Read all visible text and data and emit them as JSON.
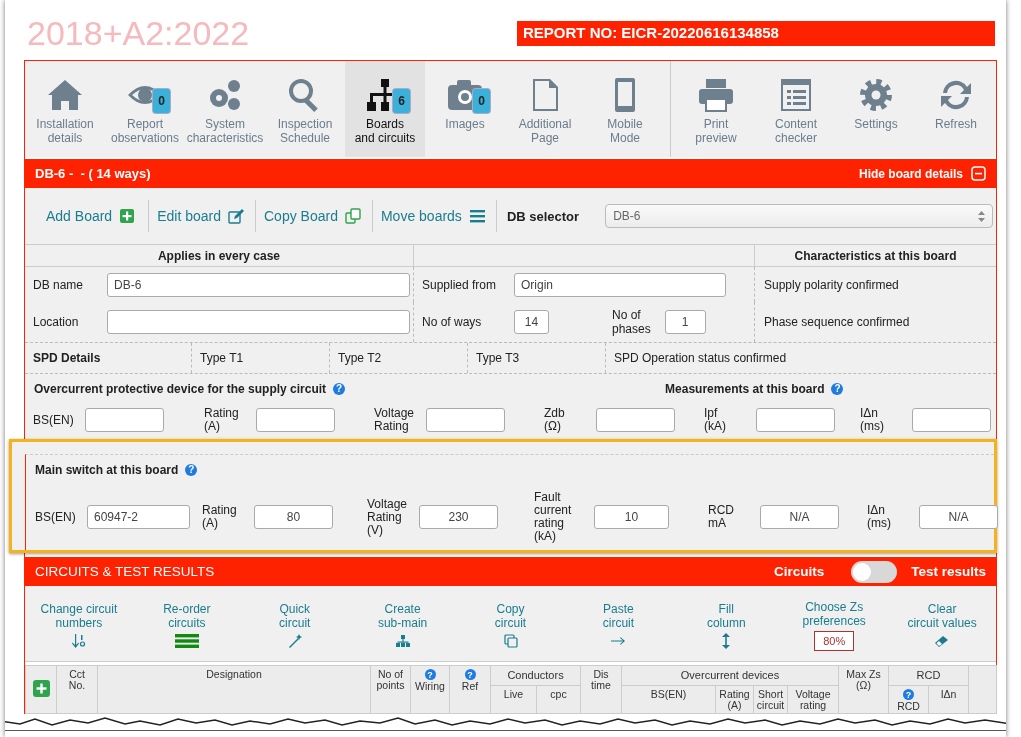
{
  "header": {
    "edition": "2018+A2:2022",
    "report_no": "REPORT NO: EICR-20220616134858"
  },
  "toolbar": [
    {
      "items": [
        {
          "label": "Installation\ndetails",
          "selected": false
        },
        {
          "label": "Report\nobservations",
          "badge": "0",
          "selected": false
        },
        {
          "label": "System\ncharacteristics",
          "selected": false
        },
        {
          "label": "Inspection\nSchedule",
          "selected": false
        },
        {
          "label": "Boards\nand circuits",
          "badge": "6",
          "selected": true
        },
        {
          "label": "Images",
          "badge": "0",
          "selected": false
        },
        {
          "label": "Additional\nPage",
          "selected": false
        },
        {
          "label": "Mobile\nMode",
          "selected": false
        }
      ]
    },
    {
      "items": [
        {
          "label": "Print\npreview",
          "selected": false
        },
        {
          "label": "Content\nchecker",
          "selected": false
        },
        {
          "label": "Settings",
          "selected": false
        },
        {
          "label": "Refresh",
          "selected": false
        }
      ]
    }
  ],
  "board": {
    "title": "DB-6 -  - ( 14 ways)",
    "hide_button": "Hide board details",
    "actions": [
      "Add Board",
      "Edit board",
      "Copy Board",
      "Move boards"
    ],
    "db_selector": {
      "label": "DB selector",
      "value": "DB-6"
    },
    "applies_heading": "Applies in every case",
    "characteristics_heading": "Characteristics at this board",
    "db_name": {
      "label": "DB name",
      "value": "DB-6"
    },
    "location": {
      "label": "Location"
    },
    "supplied_from": {
      "label": "Supplied from",
      "value": "Origin"
    },
    "no_of_ways": {
      "label": "No of ways",
      "value": "14"
    },
    "no_of_phases": {
      "label": "No of\nphases",
      "value": "1"
    },
    "characteristics": [
      "Supply polarity confirmed",
      "Phase sequence confirmed"
    ],
    "spd": {
      "title": "SPD Details",
      "types": [
        "Type T1",
        "Type T2",
        "Type T3"
      ],
      "status": "SPD Operation status confirmed"
    },
    "overcurrent": {
      "title": "Overcurrent protective device for the supply circuit",
      "help": "?",
      "fields": [
        {
          "label": "BS(EN)"
        },
        {
          "label": "Rating\n(A)"
        },
        {
          "label": "Voltage\nRating"
        }
      ]
    },
    "measurements": {
      "title": "Measurements at this board",
      "help": "?",
      "fields": [
        {
          "label": "Zdb\n(Ω)"
        },
        {
          "label": "Ipf\n(kA)"
        },
        {
          "label": "IΔn\n(ms)"
        }
      ]
    },
    "main_switch": {
      "title": "Main switch at this board",
      "help": "?",
      "fields": [
        {
          "label": "BS(EN)",
          "value": "60947-2"
        },
        {
          "label": "Rating\n(A)",
          "value": "80"
        },
        {
          "label": "Voltage\nRating\n(V)",
          "value": "230"
        },
        {
          "label": "Fault\ncurrent\nrating\n(kA)",
          "value": "10"
        },
        {
          "label": "RCD\nmA",
          "value": "N/A"
        },
        {
          "label": "IΔn\n(ms)",
          "value": "N/A"
        }
      ]
    }
  },
  "circuits": {
    "title": "CIRCUITS & TEST RESULTS",
    "toggle": {
      "left_label": "Circuits",
      "right_label": "Test results",
      "on": false
    },
    "tools": [
      {
        "label": "Change circuit\nnumbers"
      },
      {
        "label": "Re-order\ncircuits"
      },
      {
        "label": "Quick\ncircuit"
      },
      {
        "label": "Create\nsub-main"
      },
      {
        "label": "Copy\ncircuit"
      },
      {
        "label": "Paste\ncircuit"
      },
      {
        "label": "Fill\ncolumn"
      },
      {
        "label": "Choose Zs\npreferences",
        "badge": "80%"
      },
      {
        "label": "Clear\ncircuit values"
      }
    ],
    "table_header": [
      {
        "kind": "column",
        "label": "Cct\nNo."
      },
      {
        "kind": "column",
        "label": "Designation"
      },
      {
        "kind": "column",
        "label": "No of\npoints"
      },
      {
        "kind": "column",
        "label": "Wiring",
        "help": "?"
      },
      {
        "kind": "column",
        "label": "Ref",
        "help": "?"
      },
      {
        "kind": "group",
        "label": "Conductors",
        "columns": [
          {
            "label": "Live"
          },
          {
            "label": "cpc"
          }
        ]
      },
      {
        "kind": "column",
        "label": "Dis\ntime"
      },
      {
        "kind": "group",
        "label": "Overcurrent devices",
        "columns": [
          {
            "label": "BS(EN)"
          },
          {
            "label": "Rating\n(A)"
          },
          {
            "label": "Short\ncircuit"
          },
          {
            "label": "Voltage\nrating"
          }
        ]
      },
      {
        "kind": "column",
        "label": "Max Zs\n(Ω)"
      },
      {
        "kind": "group",
        "label": "RCD",
        "columns": [
          {
            "label": "RCD",
            "help": "?"
          },
          {
            "label": "IΔn"
          }
        ]
      }
    ]
  }
}
